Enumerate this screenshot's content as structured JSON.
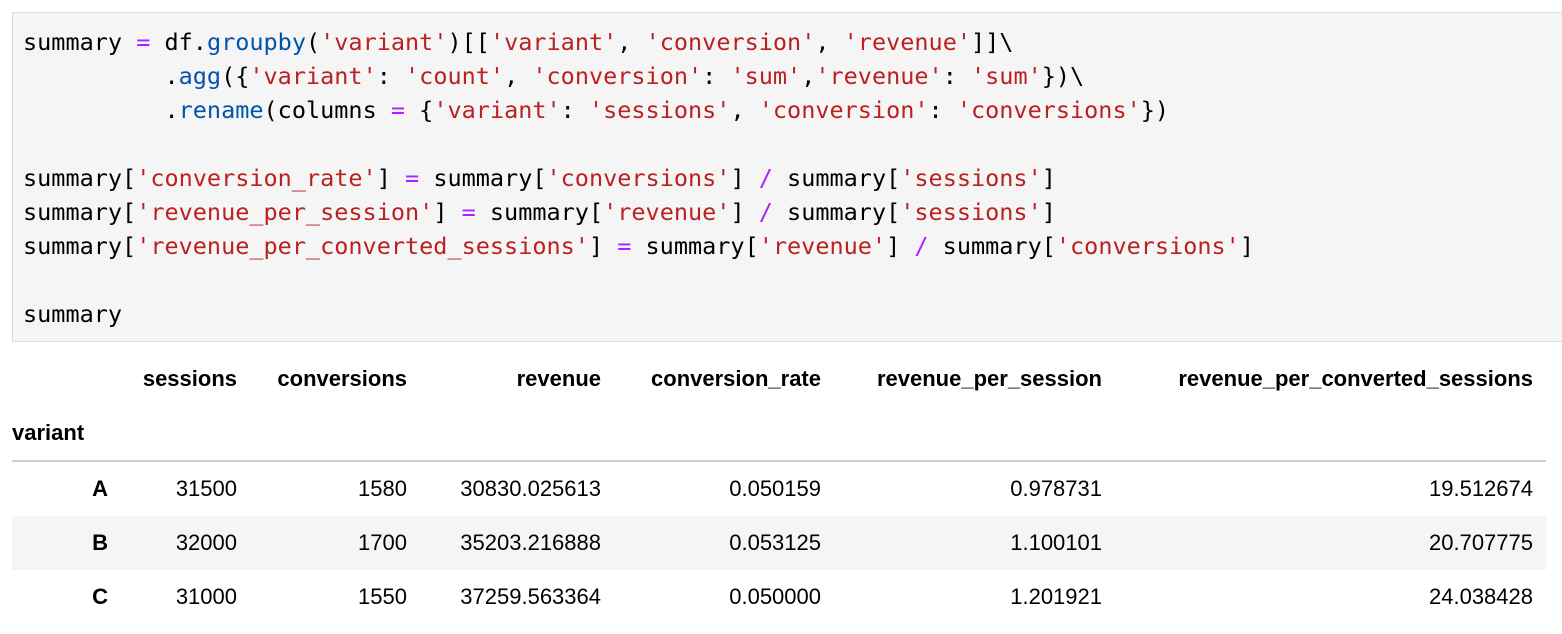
{
  "code_lines": [
    [
      {
        "t": "summary ",
        "c": "p"
      },
      {
        "t": "=",
        "c": "op"
      },
      {
        "t": " df.",
        "c": "p"
      },
      {
        "t": "groupby",
        "c": "fn"
      },
      {
        "t": "(",
        "c": "p"
      },
      {
        "t": "'variant'",
        "c": "str"
      },
      {
        "t": ")[[",
        "c": "p"
      },
      {
        "t": "'variant'",
        "c": "str"
      },
      {
        "t": ", ",
        "c": "p"
      },
      {
        "t": "'conversion'",
        "c": "str"
      },
      {
        "t": ", ",
        "c": "p"
      },
      {
        "t": "'revenue'",
        "c": "str"
      },
      {
        "t": "]]\\",
        "c": "p"
      }
    ],
    [
      {
        "t": "          .",
        "c": "p"
      },
      {
        "t": "agg",
        "c": "fn"
      },
      {
        "t": "({",
        "c": "p"
      },
      {
        "t": "'variant'",
        "c": "str"
      },
      {
        "t": ": ",
        "c": "p"
      },
      {
        "t": "'count'",
        "c": "str"
      },
      {
        "t": ", ",
        "c": "p"
      },
      {
        "t": "'conversion'",
        "c": "str"
      },
      {
        "t": ": ",
        "c": "p"
      },
      {
        "t": "'sum'",
        "c": "str"
      },
      {
        "t": ",",
        "c": "p"
      },
      {
        "t": "'revenue'",
        "c": "str"
      },
      {
        "t": ": ",
        "c": "p"
      },
      {
        "t": "'sum'",
        "c": "str"
      },
      {
        "t": "})\\",
        "c": "p"
      }
    ],
    [
      {
        "t": "          .",
        "c": "p"
      },
      {
        "t": "rename",
        "c": "fn"
      },
      {
        "t": "(columns ",
        "c": "p"
      },
      {
        "t": "=",
        "c": "op"
      },
      {
        "t": " {",
        "c": "p"
      },
      {
        "t": "'variant'",
        "c": "str"
      },
      {
        "t": ": ",
        "c": "p"
      },
      {
        "t": "'sessions'",
        "c": "str"
      },
      {
        "t": ", ",
        "c": "p"
      },
      {
        "t": "'conversion'",
        "c": "str"
      },
      {
        "t": ": ",
        "c": "p"
      },
      {
        "t": "'conversions'",
        "c": "str"
      },
      {
        "t": "})",
        "c": "p"
      }
    ],
    [],
    [
      {
        "t": "summary[",
        "c": "p"
      },
      {
        "t": "'conversion_rate'",
        "c": "str"
      },
      {
        "t": "] ",
        "c": "p"
      },
      {
        "t": "=",
        "c": "op"
      },
      {
        "t": " summary[",
        "c": "p"
      },
      {
        "t": "'conversions'",
        "c": "str"
      },
      {
        "t": "] ",
        "c": "p"
      },
      {
        "t": "/",
        "c": "op"
      },
      {
        "t": " summary[",
        "c": "p"
      },
      {
        "t": "'sessions'",
        "c": "str"
      },
      {
        "t": "]",
        "c": "p"
      }
    ],
    [
      {
        "t": "summary[",
        "c": "p"
      },
      {
        "t": "'revenue_per_session'",
        "c": "str"
      },
      {
        "t": "] ",
        "c": "p"
      },
      {
        "t": "=",
        "c": "op"
      },
      {
        "t": " summary[",
        "c": "p"
      },
      {
        "t": "'revenue'",
        "c": "str"
      },
      {
        "t": "] ",
        "c": "p"
      },
      {
        "t": "/",
        "c": "op"
      },
      {
        "t": " summary[",
        "c": "p"
      },
      {
        "t": "'sessions'",
        "c": "str"
      },
      {
        "t": "]",
        "c": "p"
      }
    ],
    [
      {
        "t": "summary[",
        "c": "p"
      },
      {
        "t": "'revenue_per_converted_sessions'",
        "c": "str"
      },
      {
        "t": "] ",
        "c": "p"
      },
      {
        "t": "=",
        "c": "op"
      },
      {
        "t": " summary[",
        "c": "p"
      },
      {
        "t": "'revenue'",
        "c": "str"
      },
      {
        "t": "] ",
        "c": "p"
      },
      {
        "t": "/",
        "c": "op"
      },
      {
        "t": " summary[",
        "c": "p"
      },
      {
        "t": "'conversions'",
        "c": "str"
      },
      {
        "t": "]",
        "c": "p"
      }
    ],
    [],
    [
      {
        "t": "summary",
        "c": "p"
      }
    ]
  ],
  "syntax_colors": {
    "operator": "#aa22ff",
    "string": "#ba2121",
    "function": "#0055aa",
    "plain": "#000000"
  },
  "table": {
    "index_name": "variant",
    "columns": [
      "sessions",
      "conversions",
      "revenue",
      "conversion_rate",
      "revenue_per_session",
      "revenue_per_converted_sessions"
    ],
    "rows": [
      {
        "index": "A",
        "values": [
          "31500",
          "1580",
          "30830.025613",
          "0.050159",
          "0.978731",
          "19.512674"
        ]
      },
      {
        "index": "B",
        "values": [
          "32000",
          "1700",
          "35203.216888",
          "0.053125",
          "1.100101",
          "20.707775"
        ]
      },
      {
        "index": "C",
        "values": [
          "31000",
          "1550",
          "37259.563364",
          "0.050000",
          "1.201921",
          "24.038428"
        ]
      }
    ]
  }
}
